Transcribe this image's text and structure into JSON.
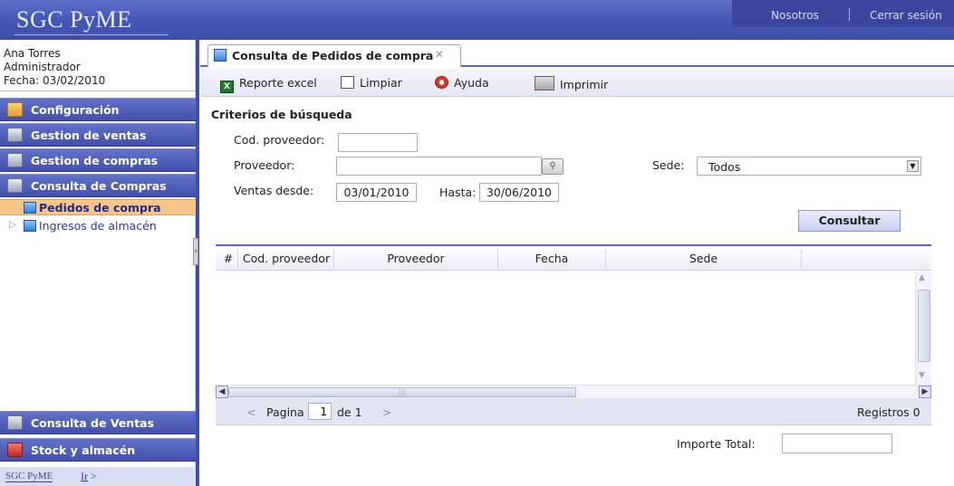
{
  "app": {
    "title": "SGC PyME"
  },
  "topnav": {
    "about": "Nosotros",
    "logout": "Cerrar sesión"
  },
  "user": {
    "name": "Ana Torres",
    "role": "Administrador",
    "date": "Fecha: 03/02/2010"
  },
  "sidebar": {
    "items": [
      {
        "label": "Configuración",
        "icon": "folder-icon"
      },
      {
        "label": "Gestion de ventas",
        "icon": "box-icon"
      },
      {
        "label": "Gestion de compras",
        "icon": "box-icon"
      },
      {
        "label": "Consulta de Compras",
        "icon": "magnifier-icon"
      }
    ],
    "sub_items": [
      {
        "label": "Pedidos de compra",
        "selected": true
      },
      {
        "label": "Ingresos de almacén",
        "selected": false
      }
    ],
    "bottom_items": [
      {
        "label": "Consulta de Ventas",
        "icon": "magnifier-icon"
      },
      {
        "label": "Stock y almacén",
        "icon": "stock-icon"
      }
    ],
    "footer": {
      "app": "SGC PyME",
      "go": "Ir",
      "go_suffix": ">"
    },
    "collapse_glyph": "‹"
  },
  "tab": {
    "label": "Consulta de Pedidos de compra",
    "close": "✕"
  },
  "toolbar": {
    "excel": "Reporte excel",
    "clear": "Limpiar",
    "help": "Ayuda",
    "print": "Imprimir"
  },
  "criteria": {
    "title": "Criterios de búsqueda",
    "supplier_code_label": "Cod. proveedor:",
    "supplier_code_value": "",
    "supplier_label": "Proveedor:",
    "supplier_value": "",
    "branch_label": "Sede:",
    "branch_value": "Todos",
    "sales_from_label": "Ventas desde:",
    "sales_from_value": "03/01/2010",
    "until_label": "Hasta:",
    "until_value": "30/06/2010",
    "search_button": "Consultar"
  },
  "grid": {
    "columns": [
      "#",
      "Cod. proveedor",
      "Proveedor",
      "Fecha",
      "Sede"
    ],
    "rows": []
  },
  "pager": {
    "prev": "<",
    "page_label": "Pagina",
    "page_value": "1",
    "of_label": "de 1",
    "next": ">",
    "records": "Registros 0"
  },
  "totals": {
    "label": "Importe Total:",
    "value": ""
  },
  "colors": {
    "header": "#4757b7",
    "nav_button": "#4250ab",
    "selected_item": "#f7c58a",
    "accent": "#5a67c2"
  }
}
